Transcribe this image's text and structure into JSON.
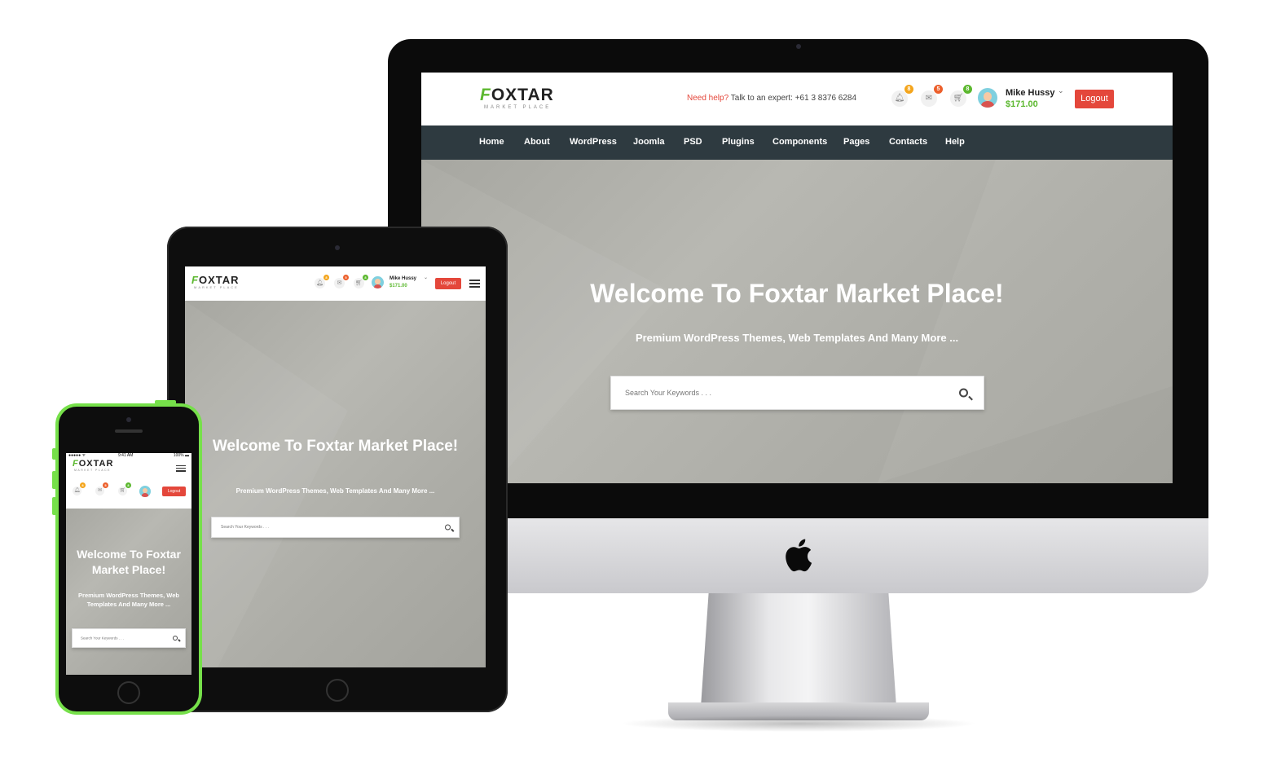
{
  "brand": {
    "logo_word_first": "F",
    "logo_word_rest": "OXTAR",
    "logo_sub": "MARKET PLACE",
    "green": "#5cb82f",
    "red": "#e4473b",
    "nav_bg": "#2e3a40"
  },
  "header": {
    "help_label": "Need help?",
    "help_text": "Talk to an expert: +61 3 8376 6284",
    "notifications_count": "8",
    "messages_count": "5",
    "cart_count": "8",
    "user_name": "Mike Hussy",
    "user_balance": "$171.00",
    "logout_label": "Logout"
  },
  "nav": {
    "items": [
      "Home",
      "About",
      "WordPress",
      "Joomla",
      "PSD",
      "Plugins",
      "Components",
      "Pages",
      "Contacts",
      "Help"
    ]
  },
  "hero": {
    "title": "Welcome To Foxtar Market Place!",
    "subtitle": "Premium WordPress Themes, Web Templates And Many More ...",
    "search_placeholder": "Search Your Keywords . . ."
  },
  "phone_status": {
    "carrier": "●●●●● ᯤ",
    "time": "9:41 AM",
    "battery": "100% ▬"
  },
  "icons": {
    "bell": "bell-icon",
    "mail": "mail-icon",
    "cart": "cart-icon",
    "search": "search-icon",
    "menu": "hamburger-menu-icon",
    "apple": "apple-logo-icon"
  }
}
